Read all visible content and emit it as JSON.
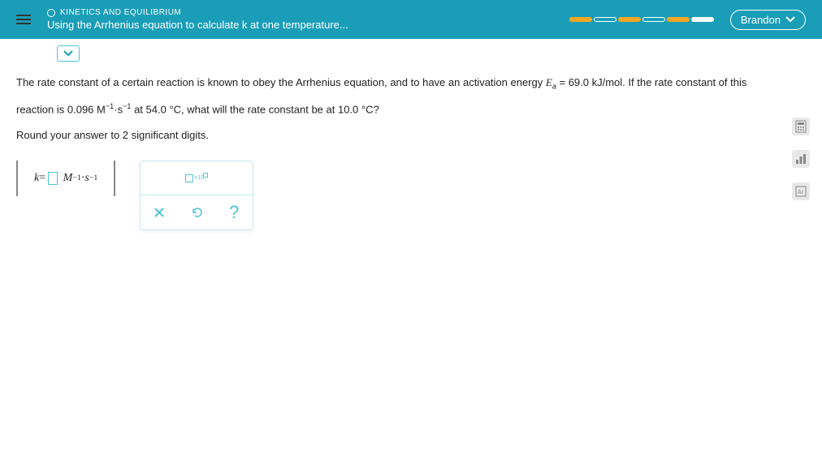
{
  "header": {
    "breadcrumb": "KINETICS AND EQUILIBRIUM",
    "title": "Using the Arrhenius equation to calculate k at one temperature...",
    "user": "Brandon"
  },
  "problem": {
    "line1_a": "The rate constant of a certain reaction is known to obey the Arrhenius equation, and to have an activation energy ",
    "Ea_sym": "E",
    "Ea_sub": "a",
    "Ea_eq": " = 69.0  kJ/mol.",
    "line1_b": " If the rate constant of this",
    "line2_a": "reaction is ",
    "k1_val": "0.096  M",
    "exp_m1": "−1",
    "dot_s": "·s",
    "line2_b": " at ",
    "T1": "54.0 °C,",
    "line2_c": " what will the rate constant be at ",
    "T2": "10.0 °C?",
    "round": "Round your answer to ",
    "sigfig": "2",
    "round_end": " significant digits."
  },
  "answer": {
    "k_eq": "k",
    "equals": " = ",
    "M": "M",
    "neg1": "−1",
    "dot": " · ",
    "s": "s"
  },
  "tools": {
    "sci_label": "×10"
  }
}
